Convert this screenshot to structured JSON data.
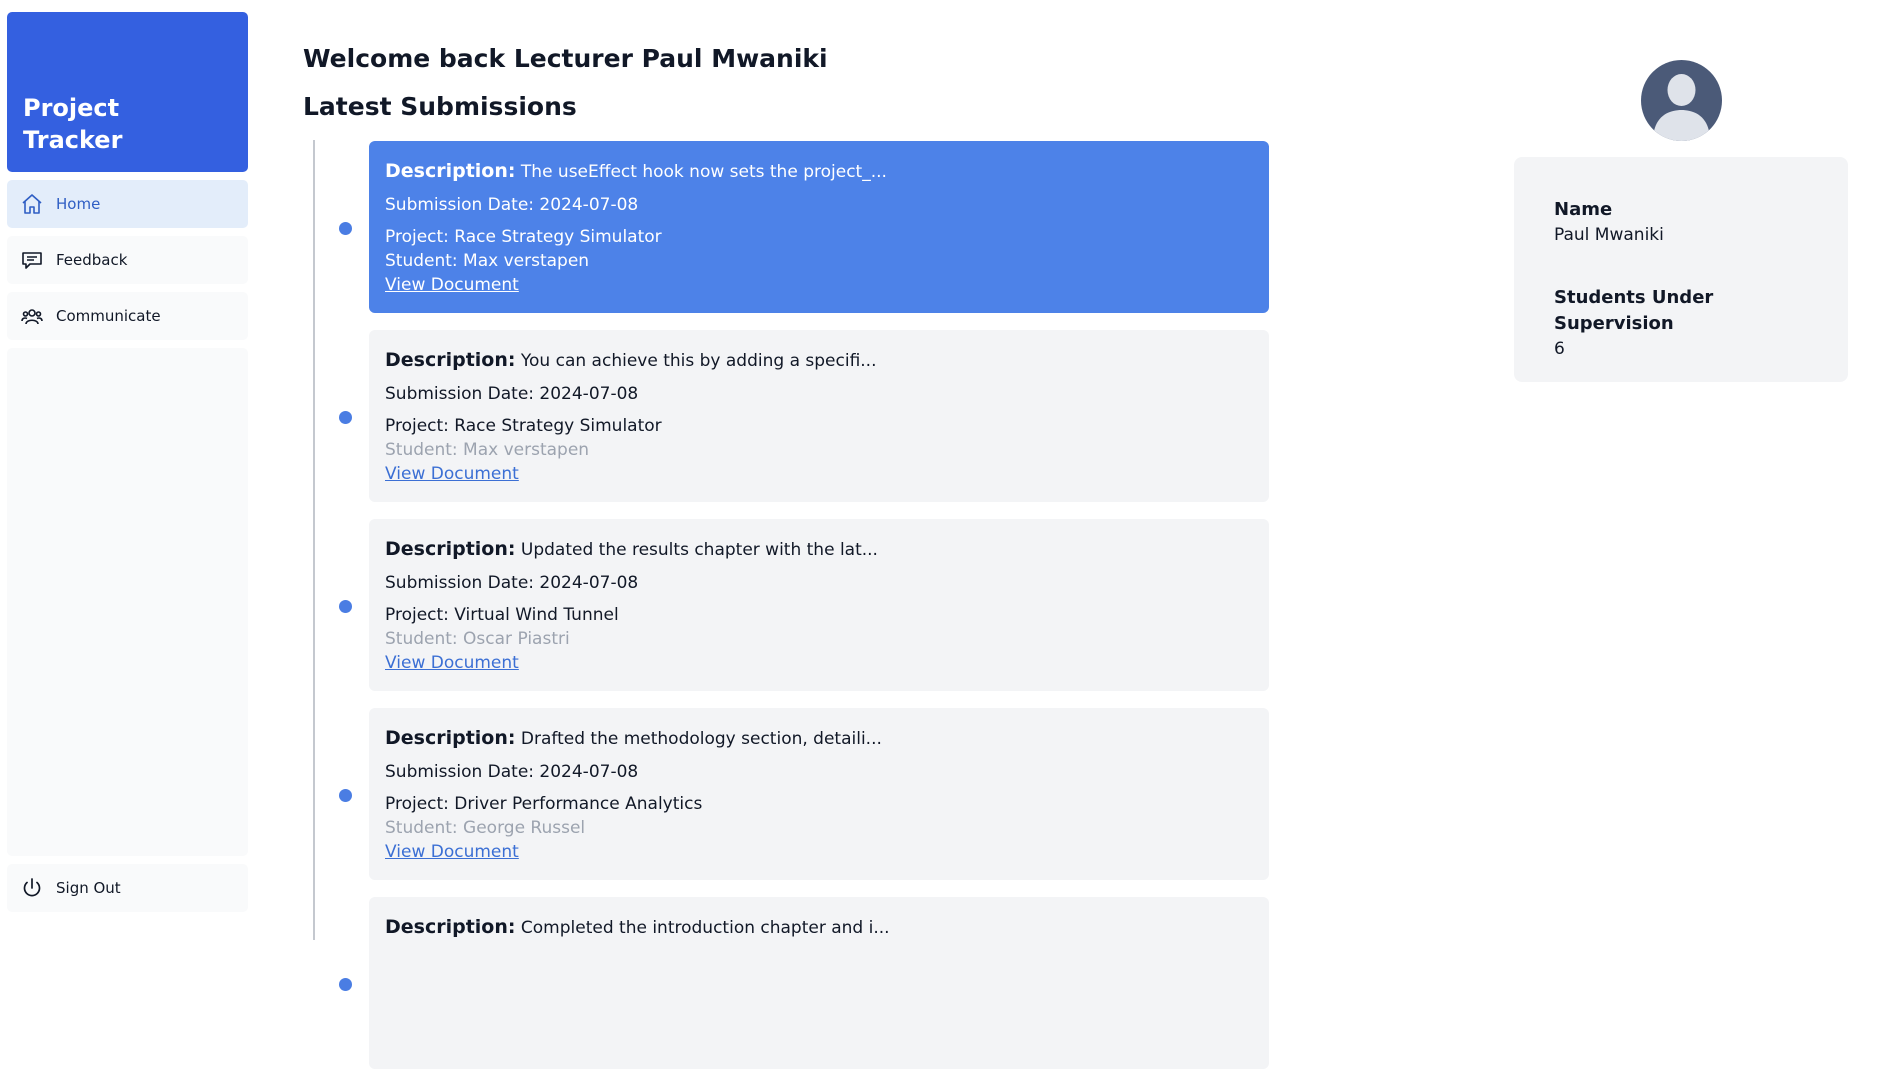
{
  "sidebar": {
    "brand": "Project Tracker",
    "items": [
      {
        "label": "Home",
        "icon": "home-icon"
      },
      {
        "label": "Feedback",
        "icon": "message-icon"
      },
      {
        "label": "Communicate",
        "icon": "users-icon"
      }
    ],
    "signout": {
      "label": "Sign Out",
      "icon": "power-icon"
    }
  },
  "main": {
    "welcome": "Welcome back Lecturer Paul Mwaniki",
    "section_title": "Latest Submissions",
    "labels": {
      "description": "Description:",
      "view_document": "View Document"
    },
    "submissions": [
      {
        "description": "The useEffect hook now sets the project_...",
        "date": "Submission Date: 2024-07-08",
        "project": "Project: Race Strategy Simulator",
        "student": "Student: Max verstapen"
      },
      {
        "description": "You can achieve this by adding a specifi...",
        "date": "Submission Date: 2024-07-08",
        "project": "Project: Race Strategy Simulator",
        "student": "Student: Max verstapen"
      },
      {
        "description": "Updated the results chapter with the lat...",
        "date": "Submission Date: 2024-07-08",
        "project": "Project: Virtual Wind Tunnel",
        "student": "Student: Oscar Piastri"
      },
      {
        "description": "Drafted the methodology section, detaili...",
        "date": "Submission Date: 2024-07-08",
        "project": "Project: Driver Performance Analytics",
        "student": "Student: George Russel"
      },
      {
        "description": "Completed the introduction chapter and i...",
        "date": "",
        "project": "",
        "student": ""
      }
    ]
  },
  "profile": {
    "name_label": "Name",
    "name": "Paul Mwaniki",
    "supervision_label": "Students Under Supervision",
    "supervision_count": "6"
  },
  "colors": {
    "brand": "#3460e0",
    "active_card": "#4d82e8",
    "active_nav_bg": "#e3edfa",
    "link": "#3b6fd4",
    "avatar": "#4b5a78"
  }
}
